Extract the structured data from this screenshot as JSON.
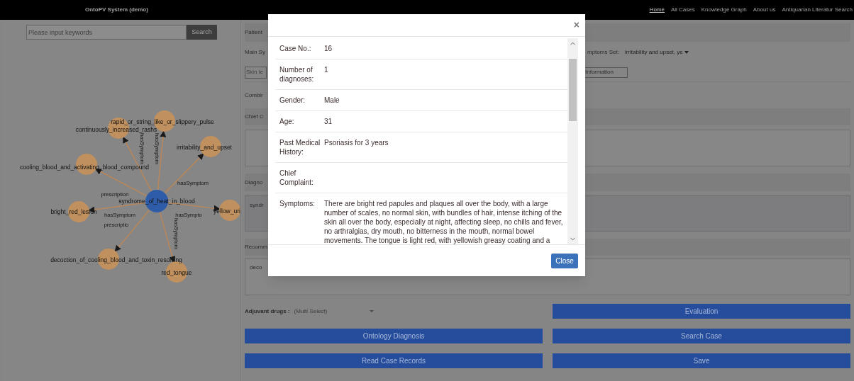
{
  "navbar": {
    "brand": "OntoPV System (demo)",
    "links": [
      {
        "label": "Home",
        "selected": true
      },
      {
        "label": "All Cases",
        "selected": false
      },
      {
        "label": "Knowledge Graph",
        "selected": false
      },
      {
        "label": "About us",
        "selected": false
      },
      {
        "label": "Antiquarian Literatur Search",
        "selected": false
      }
    ]
  },
  "search": {
    "placeholder": "Please input keywords",
    "button": "Search"
  },
  "graph": {
    "nodes": [
      {
        "label": "rapid_or_string_like_or_slippery_pulse",
        "kind": "related",
        "edge_label": "hasSymptom"
      },
      {
        "label": "continuously_increased_rashs",
        "kind": "related",
        "edge_label": "hasSymptom"
      },
      {
        "label": "irritability_and_upset",
        "kind": "related",
        "edge_label": "hasSymptom"
      },
      {
        "label": "cooling_blood_and_activating_blood_compound",
        "kind": "related",
        "edge_label": "prescription"
      },
      {
        "label": "syndrome_of_heat_in_blood",
        "kind": "center"
      },
      {
        "label": "bright_red_lesion",
        "kind": "related",
        "edge_label": "hasSymptom"
      },
      {
        "label": "yellow_uri",
        "kind": "related",
        "edge_label": "hasSympto"
      },
      {
        "label": "decoction_of_cooling_blood_and_toxin_resolving",
        "kind": "related",
        "edge_label": "prescriptio"
      },
      {
        "label": "red_tongue",
        "kind": "related",
        "edge_label": "hasSymptom"
      }
    ]
  },
  "form": {
    "patient_header": "Patient",
    "main_label": "Main Sy",
    "symptoms_set_label": "mptoms Set:",
    "symptoms_set_value": "irritability and upset, ye",
    "skin_field": "Skin le",
    "information_button": "Information",
    "combined_label": "Combir",
    "chief_header": "Chief C",
    "diagnosis_header": "Diagno",
    "diagnosis_value": "syndr",
    "recommend_header": "Recomm",
    "recommend_value": "deco",
    "adjuvant_label": "Adjuvant drugs :",
    "adjuvant_placeholder": "(Multi Select)",
    "buttons": [
      "Evaluation",
      "Ontology Diagnosis",
      "Search Case",
      "Read Case Records",
      "Save"
    ]
  },
  "modal": {
    "close_icon": "×",
    "rows": [
      {
        "label": "Case No.:",
        "value": "16"
      },
      {
        "label": "Number of diagnoses:",
        "value": "1"
      },
      {
        "label": "Gender:",
        "value": "Male"
      },
      {
        "label": "Age:",
        "value": "31"
      },
      {
        "label": "Past Medical History:",
        "value": "Psoriasis for 3 years"
      },
      {
        "label": "Chief Complaint:"
      },
      {
        "label": "Symptoms:",
        "value": "There are bright red papules and plaques all over the body, with a large number of scales, no normal skin, with bundles of hair, intense itching of the skin all over the body, especially at night, affecting sleep, no chills and fever, no arthralgias, dry mouth, no bitterness in the mouth, normal bowel movements. The tongue is light red, with yellowish greasy coating and a"
      }
    ],
    "close_button": "Close"
  }
}
